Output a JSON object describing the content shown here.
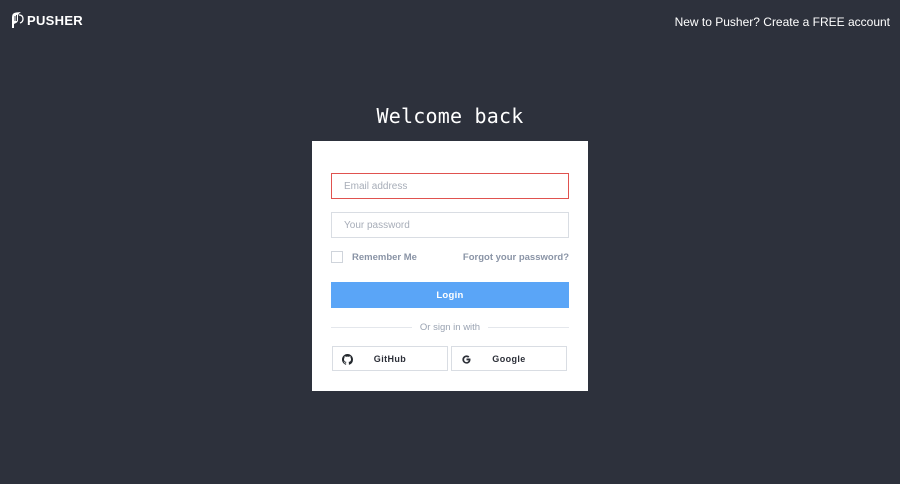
{
  "header": {
    "brand": "PUSHER",
    "logo_icon": "pusher-logo-icon",
    "signup_text": "New to Pusher? Create a FREE account"
  },
  "main": {
    "title": "Welcome back"
  },
  "form": {
    "email": {
      "value": "",
      "placeholder": "Email address"
    },
    "password": {
      "value": "",
      "placeholder": "Your password"
    },
    "remember_label": "Remember Me",
    "remember_checked": false,
    "forgot_label": "Forgot your password?",
    "login_label": "Login",
    "divider_text": "Or sign in with",
    "social": {
      "github_label": "GitHub",
      "github_icon": "github-icon",
      "google_label": "Google",
      "google_icon": "google-icon"
    }
  },
  "colors": {
    "background": "#2d313c",
    "card": "#ffffff",
    "primary_button": "#5aa5f7",
    "error_border": "#e0524f"
  }
}
